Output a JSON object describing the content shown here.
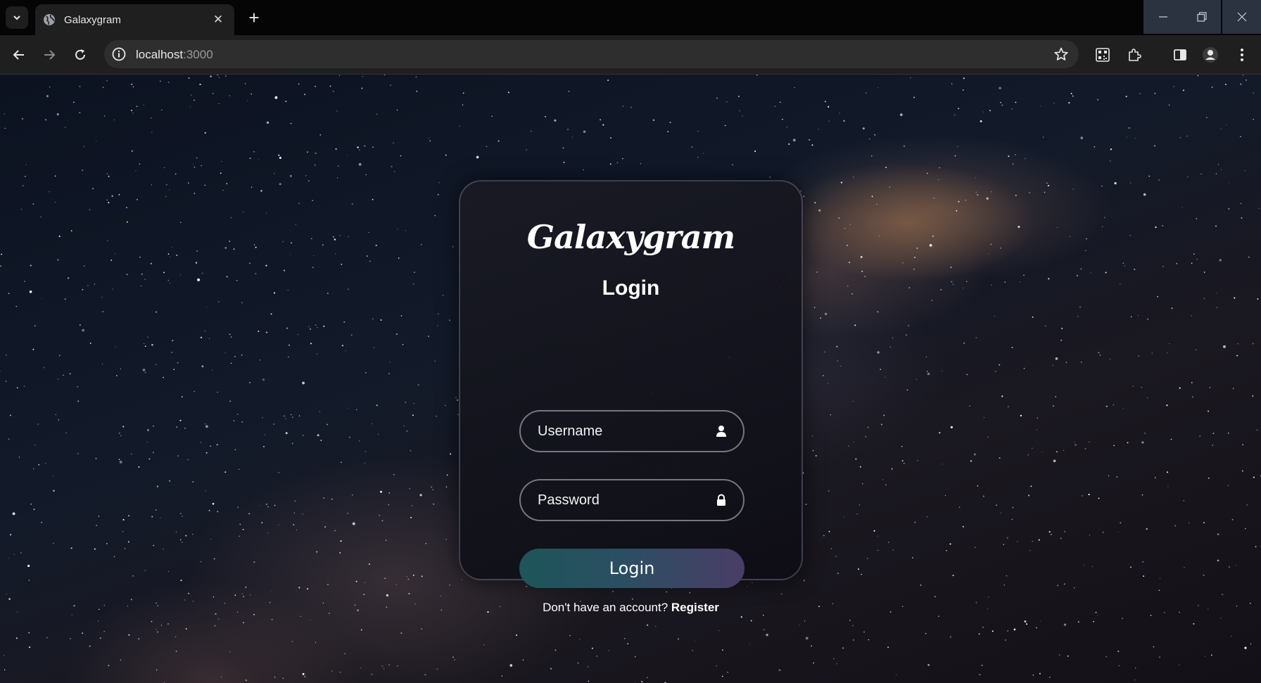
{
  "browser": {
    "tab_title": "Galaxygram",
    "url_host": "localhost",
    "url_port": ":3000"
  },
  "login": {
    "brand": "Galaxygram",
    "heading": "Login",
    "username_placeholder": "Username",
    "password_placeholder": "Password",
    "button_label": "Login",
    "register_prompt": "Don't have an account?",
    "register_link": "Register"
  },
  "colors": {
    "button_start": "#1d5559",
    "button_end": "#4a3d66"
  }
}
